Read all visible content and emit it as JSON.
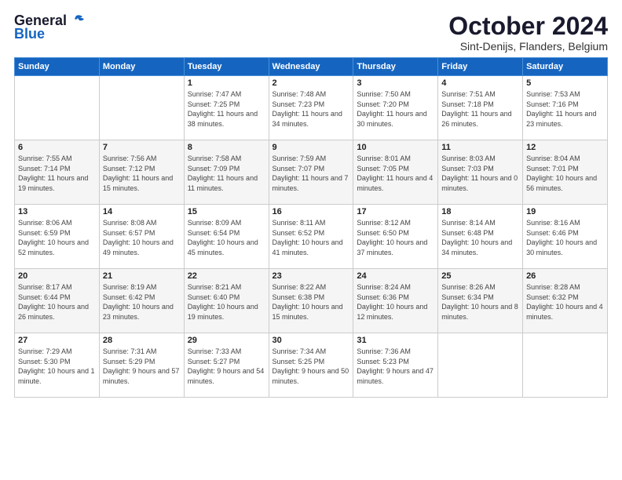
{
  "header": {
    "logo_line1": "General",
    "logo_line2": "Blue",
    "title": "October 2024",
    "subtitle": "Sint-Denijs, Flanders, Belgium"
  },
  "days_of_week": [
    "Sunday",
    "Monday",
    "Tuesday",
    "Wednesday",
    "Thursday",
    "Friday",
    "Saturday"
  ],
  "weeks": [
    [
      {
        "day": "",
        "info": ""
      },
      {
        "day": "",
        "info": ""
      },
      {
        "day": "1",
        "info": "Sunrise: 7:47 AM\nSunset: 7:25 PM\nDaylight: 11 hours and 38 minutes."
      },
      {
        "day": "2",
        "info": "Sunrise: 7:48 AM\nSunset: 7:23 PM\nDaylight: 11 hours and 34 minutes."
      },
      {
        "day": "3",
        "info": "Sunrise: 7:50 AM\nSunset: 7:20 PM\nDaylight: 11 hours and 30 minutes."
      },
      {
        "day": "4",
        "info": "Sunrise: 7:51 AM\nSunset: 7:18 PM\nDaylight: 11 hours and 26 minutes."
      },
      {
        "day": "5",
        "info": "Sunrise: 7:53 AM\nSunset: 7:16 PM\nDaylight: 11 hours and 23 minutes."
      }
    ],
    [
      {
        "day": "6",
        "info": "Sunrise: 7:55 AM\nSunset: 7:14 PM\nDaylight: 11 hours and 19 minutes."
      },
      {
        "day": "7",
        "info": "Sunrise: 7:56 AM\nSunset: 7:12 PM\nDaylight: 11 hours and 15 minutes."
      },
      {
        "day": "8",
        "info": "Sunrise: 7:58 AM\nSunset: 7:09 PM\nDaylight: 11 hours and 11 minutes."
      },
      {
        "day": "9",
        "info": "Sunrise: 7:59 AM\nSunset: 7:07 PM\nDaylight: 11 hours and 7 minutes."
      },
      {
        "day": "10",
        "info": "Sunrise: 8:01 AM\nSunset: 7:05 PM\nDaylight: 11 hours and 4 minutes."
      },
      {
        "day": "11",
        "info": "Sunrise: 8:03 AM\nSunset: 7:03 PM\nDaylight: 11 hours and 0 minutes."
      },
      {
        "day": "12",
        "info": "Sunrise: 8:04 AM\nSunset: 7:01 PM\nDaylight: 10 hours and 56 minutes."
      }
    ],
    [
      {
        "day": "13",
        "info": "Sunrise: 8:06 AM\nSunset: 6:59 PM\nDaylight: 10 hours and 52 minutes."
      },
      {
        "day": "14",
        "info": "Sunrise: 8:08 AM\nSunset: 6:57 PM\nDaylight: 10 hours and 49 minutes."
      },
      {
        "day": "15",
        "info": "Sunrise: 8:09 AM\nSunset: 6:54 PM\nDaylight: 10 hours and 45 minutes."
      },
      {
        "day": "16",
        "info": "Sunrise: 8:11 AM\nSunset: 6:52 PM\nDaylight: 10 hours and 41 minutes."
      },
      {
        "day": "17",
        "info": "Sunrise: 8:12 AM\nSunset: 6:50 PM\nDaylight: 10 hours and 37 minutes."
      },
      {
        "day": "18",
        "info": "Sunrise: 8:14 AM\nSunset: 6:48 PM\nDaylight: 10 hours and 34 minutes."
      },
      {
        "day": "19",
        "info": "Sunrise: 8:16 AM\nSunset: 6:46 PM\nDaylight: 10 hours and 30 minutes."
      }
    ],
    [
      {
        "day": "20",
        "info": "Sunrise: 8:17 AM\nSunset: 6:44 PM\nDaylight: 10 hours and 26 minutes."
      },
      {
        "day": "21",
        "info": "Sunrise: 8:19 AM\nSunset: 6:42 PM\nDaylight: 10 hours and 23 minutes."
      },
      {
        "day": "22",
        "info": "Sunrise: 8:21 AM\nSunset: 6:40 PM\nDaylight: 10 hours and 19 minutes."
      },
      {
        "day": "23",
        "info": "Sunrise: 8:22 AM\nSunset: 6:38 PM\nDaylight: 10 hours and 15 minutes."
      },
      {
        "day": "24",
        "info": "Sunrise: 8:24 AM\nSunset: 6:36 PM\nDaylight: 10 hours and 12 minutes."
      },
      {
        "day": "25",
        "info": "Sunrise: 8:26 AM\nSunset: 6:34 PM\nDaylight: 10 hours and 8 minutes."
      },
      {
        "day": "26",
        "info": "Sunrise: 8:28 AM\nSunset: 6:32 PM\nDaylight: 10 hours and 4 minutes."
      }
    ],
    [
      {
        "day": "27",
        "info": "Sunrise: 7:29 AM\nSunset: 5:30 PM\nDaylight: 10 hours and 1 minute."
      },
      {
        "day": "28",
        "info": "Sunrise: 7:31 AM\nSunset: 5:29 PM\nDaylight: 9 hours and 57 minutes."
      },
      {
        "day": "29",
        "info": "Sunrise: 7:33 AM\nSunset: 5:27 PM\nDaylight: 9 hours and 54 minutes."
      },
      {
        "day": "30",
        "info": "Sunrise: 7:34 AM\nSunset: 5:25 PM\nDaylight: 9 hours and 50 minutes."
      },
      {
        "day": "31",
        "info": "Sunrise: 7:36 AM\nSunset: 5:23 PM\nDaylight: 9 hours and 47 minutes."
      },
      {
        "day": "",
        "info": ""
      },
      {
        "day": "",
        "info": ""
      }
    ]
  ]
}
